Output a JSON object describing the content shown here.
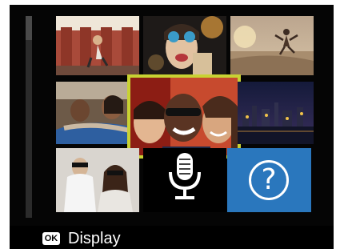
{
  "thumbnail_grid": {
    "tiles": [
      {
        "name": "thumb-red-wall-jumper",
        "kind": "photo"
      },
      {
        "name": "thumb-party-binoculars",
        "kind": "photo"
      },
      {
        "name": "thumb-beach-jump",
        "kind": "photo"
      },
      {
        "name": "thumb-couch-friends",
        "kind": "photo"
      },
      {
        "name": "thumb-friends-selfie",
        "kind": "photo",
        "selected": true
      },
      {
        "name": "thumb-city-night",
        "kind": "photo"
      },
      {
        "name": "thumb-white-outfit-friends",
        "kind": "photo"
      },
      {
        "name": "thumb-voice-memo",
        "kind": "voice",
        "icon": "microphone-icon"
      },
      {
        "name": "thumb-help",
        "kind": "help",
        "icon": "question-mark-icon",
        "glyph": "?"
      }
    ],
    "selection_color": "#c8d233",
    "help_tile_color": "#2a77bd"
  },
  "bottom_bar": {
    "ok_badge": "OK",
    "action_label": "Display"
  }
}
